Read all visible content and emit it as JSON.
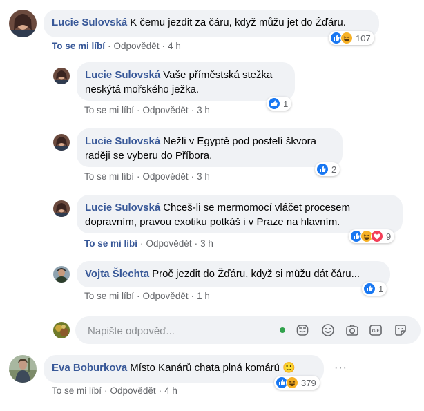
{
  "comments": [
    {
      "author": "Lucie Sulovská",
      "text": "K čemu jezdit za čáru, když můžu jet do Žďáru.",
      "like_label": "To se mi líbí",
      "reply_label": "Odpovědět",
      "time": "4 h",
      "reactions": [
        "like",
        "haha"
      ],
      "reaction_count": "107",
      "like_active": true
    },
    {
      "author": "Lucie Sulovská",
      "text_line1": "Vaše příměstská stežka",
      "text_line2": "neskýtá mořského ježka.",
      "like_label": "To se mi líbí",
      "reply_label": "Odpovědět",
      "time": "3 h",
      "reactions": [
        "like"
      ],
      "reaction_count": "1"
    },
    {
      "author": "Lucie Sulovská",
      "text_line1": "Nežli v Egyptě pod postelí škvora",
      "text_line2": "raději se vyberu do Příbora.",
      "like_label": "To se mi líbí",
      "reply_label": "Odpovědět",
      "time": "3 h",
      "reactions": [
        "like"
      ],
      "reaction_count": "2"
    },
    {
      "author": "Lucie Sulovská",
      "text_line1": "Chceš-li se mermomocí vláčet procesem",
      "text_line2": "dopravním, pravou exotiku potkáš i v Praze na hlavním.",
      "like_label": "To se mi líbí",
      "reply_label": "Odpovědět",
      "time": "3 h",
      "reactions": [
        "like",
        "haha",
        "love"
      ],
      "reaction_count": "9",
      "like_active": true
    },
    {
      "author": "Vojta Šlechta",
      "text": "Proč jezdit do Žďáru, když si můžu dát čáru...",
      "like_label": "To se mi líbí",
      "reply_label": "Odpovědět",
      "time": "1 h",
      "reactions": [
        "like"
      ],
      "reaction_count": "1"
    },
    {
      "author": "Eva Boburkova",
      "text": "Místo Kanárů chata plná komárů",
      "emoji": "🙂",
      "like_label": "To se mi líbí",
      "reply_label": "Odpovědět",
      "time": "4 h",
      "reactions": [
        "like",
        "haha"
      ],
      "reaction_count": "379",
      "more": "···"
    }
  ],
  "reply_input": {
    "placeholder": "Napište odpověď...",
    "tools": [
      "emoji-icon",
      "camera-icon",
      "gif-icon",
      "sticker-icon",
      "avatar-sticker-icon"
    ]
  },
  "colors": {
    "author": "#385898",
    "bubble": "#f0f2f5",
    "meta": "#65676b",
    "like_blue": "#1877f2",
    "haha_yellow": "#f7b125",
    "love_red": "#f33e58",
    "online_green": "#31a24c"
  }
}
